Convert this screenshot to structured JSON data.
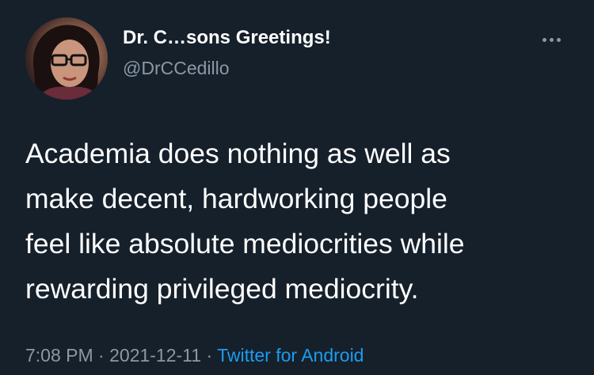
{
  "author": {
    "display_name": "Dr. C…sons Greetings!",
    "handle": "@DrCCedillo"
  },
  "tweet": {
    "lines": [
      "Academia does nothing as well as",
      "make decent, hardworking people",
      "feel like absolute mediocrities while",
      "rewarding privileged mediocrity."
    ]
  },
  "meta": {
    "time": "7:08 PM",
    "date": "2021-12-11",
    "separator": "·",
    "source": "Twitter for Android"
  },
  "icons": {
    "more": "more-options-icon"
  },
  "colors": {
    "background": "#15202b",
    "text_primary": "#ffffff",
    "text_secondary": "#8b98a5",
    "link": "#1d9bf0"
  }
}
